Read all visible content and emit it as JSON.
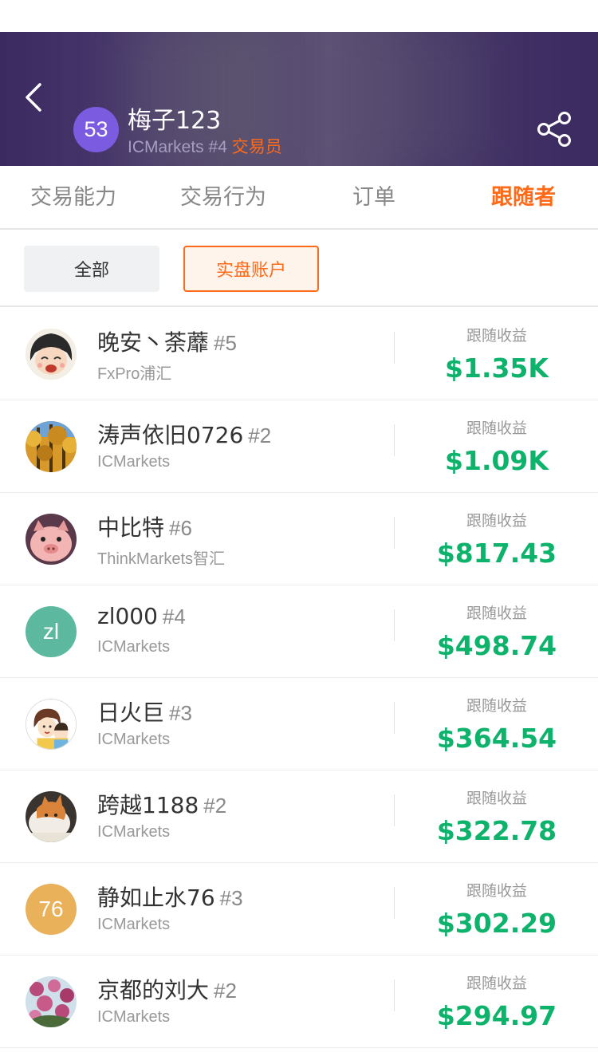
{
  "header": {
    "avatar_text": "53",
    "name": "梅子123",
    "broker": "ICMarkets",
    "rank": "#4",
    "role": "交易员"
  },
  "tabs": [
    {
      "label": "交易能力"
    },
    {
      "label": "交易行为"
    },
    {
      "label": "订单"
    },
    {
      "label": "跟随者"
    }
  ],
  "filters": {
    "all": "全部",
    "live": "实盘账户"
  },
  "colors": {
    "accent": "#ff6a18",
    "earn": "#0db26b",
    "header_bg": "#3a2a60"
  },
  "followers": [
    {
      "name": "晚安丶荼蘼",
      "rank": "#5",
      "broker": "FxPro浦汇",
      "earn_label": "跟随收益",
      "earn": "$1.35K",
      "avatar": "photo-girl-icon"
    },
    {
      "name": "涛声依旧0726",
      "rank": "#2",
      "broker": "ICMarkets",
      "earn_label": "跟随收益",
      "earn": "$1.09K",
      "avatar": "photo-forest-icon"
    },
    {
      "name": "中比特",
      "rank": "#6",
      "broker": "ThinkMarkets智汇",
      "earn_label": "跟随收益",
      "earn": "$817.43",
      "avatar": "photo-pig-icon"
    },
    {
      "name": "zl000",
      "rank": "#4",
      "broker": "ICMarkets",
      "earn_label": "跟随收益",
      "earn": "$498.74",
      "avatar_text": "zl"
    },
    {
      "name": "日火巨",
      "rank": "#3",
      "broker": "ICMarkets",
      "earn_label": "跟随收益",
      "earn": "$364.54",
      "avatar": "photo-cartoon-icon"
    },
    {
      "name": "跨越1188",
      "rank": "#2",
      "broker": "ICMarkets",
      "earn_label": "跟随收益",
      "earn": "$322.78",
      "avatar": "photo-cat-icon"
    },
    {
      "name": "静如止水76",
      "rank": "#3",
      "broker": "ICMarkets",
      "earn_label": "跟随收益",
      "earn": "$302.29",
      "avatar_text": "76"
    },
    {
      "name": "京都的刘大",
      "rank": "#2",
      "broker": "ICMarkets",
      "earn_label": "跟随收益",
      "earn": "$294.97",
      "avatar": "photo-flowers-icon"
    }
  ]
}
